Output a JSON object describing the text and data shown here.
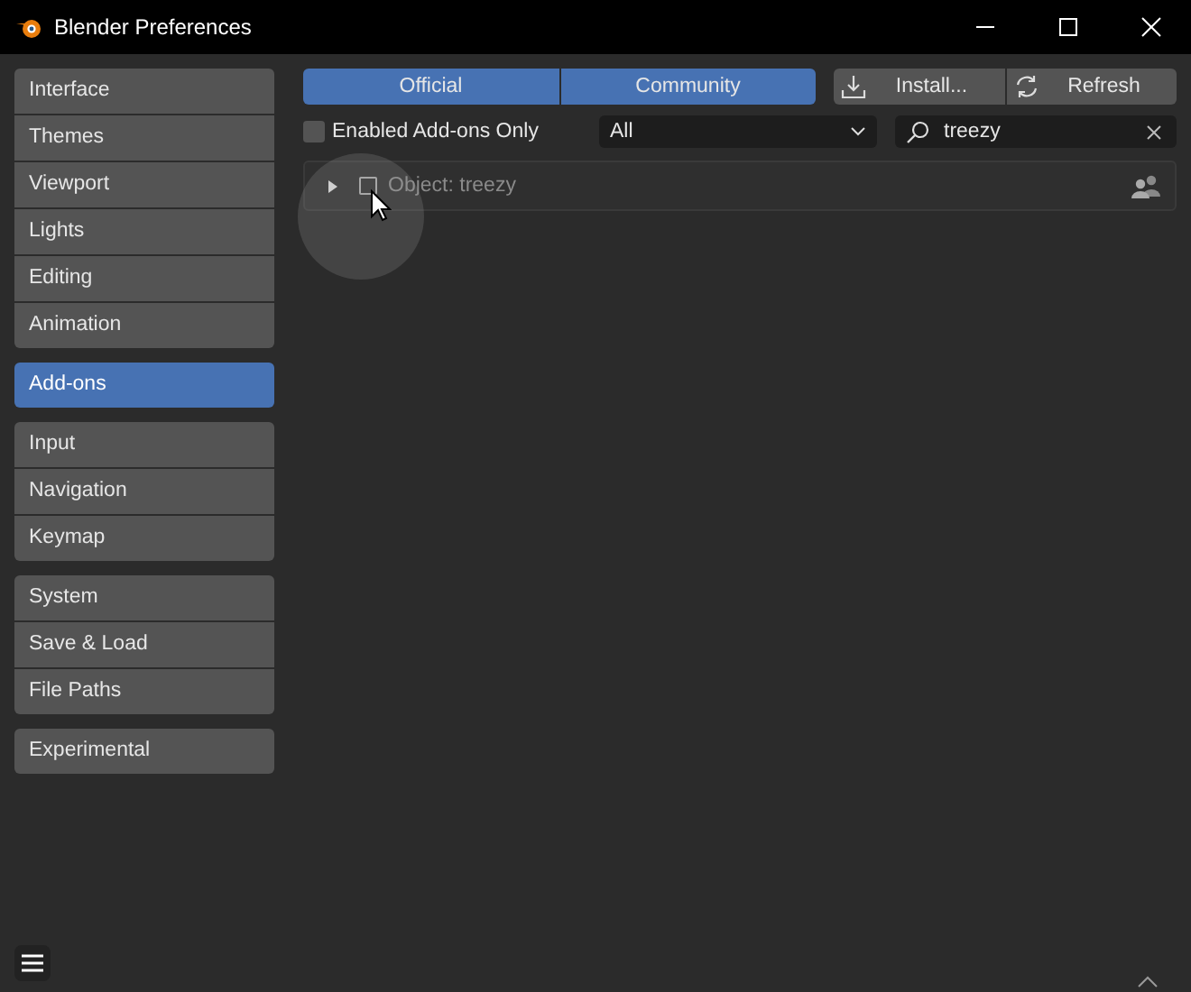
{
  "window": {
    "title": "Blender Preferences"
  },
  "sidebar": {
    "groups": [
      {
        "items": [
          {
            "label": "Interface",
            "selected": false
          },
          {
            "label": "Themes",
            "selected": false
          },
          {
            "label": "Viewport",
            "selected": false
          },
          {
            "label": "Lights",
            "selected": false
          },
          {
            "label": "Editing",
            "selected": false
          },
          {
            "label": "Animation",
            "selected": false
          }
        ]
      },
      {
        "items": [
          {
            "label": "Add-ons",
            "selected": true
          }
        ]
      },
      {
        "items": [
          {
            "label": "Input",
            "selected": false
          },
          {
            "label": "Navigation",
            "selected": false
          },
          {
            "label": "Keymap",
            "selected": false
          }
        ]
      },
      {
        "items": [
          {
            "label": "System",
            "selected": false
          },
          {
            "label": "Save & Load",
            "selected": false
          },
          {
            "label": "File Paths",
            "selected": false
          }
        ]
      },
      {
        "items": [
          {
            "label": "Experimental",
            "selected": false
          }
        ]
      }
    ]
  },
  "toolbar": {
    "tabs": [
      {
        "label": "Official",
        "selected": true
      },
      {
        "label": "Community",
        "selected": true
      }
    ],
    "buttons": [
      {
        "kind": "install",
        "label": "Install..."
      },
      {
        "kind": "refresh",
        "label": "Refresh"
      }
    ]
  },
  "filters": {
    "enabled_only": {
      "label": "Enabled Add-ons Only",
      "checked": false
    },
    "category": "All",
    "search": {
      "value": "treezy"
    }
  },
  "addons": [
    {
      "name": "Object: treezy",
      "expanded": false,
      "enabled": false
    }
  ]
}
